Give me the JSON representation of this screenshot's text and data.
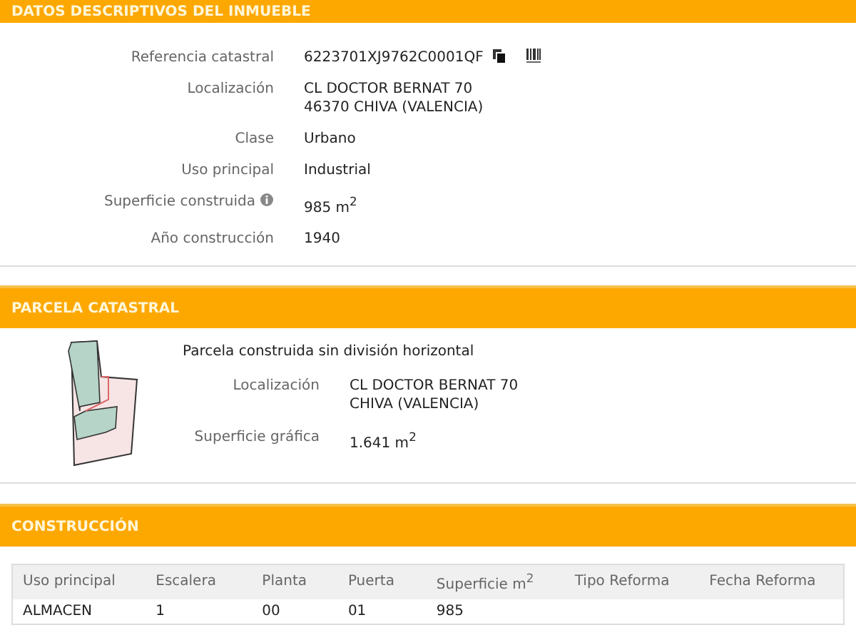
{
  "inmueble": {
    "title": "DATOS DESCRIPTIVOS DEL INMUEBLE",
    "fields": [
      {
        "kind": "ref",
        "label": "Referencia catastral",
        "value": [
          "6223701XJ9762C0001QF"
        ]
      },
      {
        "kind": "plain",
        "label": "Localización",
        "value": [
          "CL DOCTOR BERNAT 70",
          "46370 CHIVA (VALENCIA)"
        ]
      },
      {
        "kind": "plain",
        "label": "Clase",
        "value": [
          "Urbano"
        ]
      },
      {
        "kind": "plain",
        "label": "Uso principal",
        "value": [
          "Industrial"
        ]
      },
      {
        "kind": "info",
        "label": "Superficie construida",
        "value": [
          "985 m$^{2}$"
        ]
      },
      {
        "kind": "plain",
        "label": "Año construcción",
        "value": [
          "1940"
        ]
      }
    ]
  },
  "parcela": {
    "title": "PARCELA CATASTRAL",
    "description": "Parcela construida sin división horizontal",
    "fields": [
      {
        "label": "Localización",
        "value": [
          "CL DOCTOR BERNAT 70",
          "CHIVA (VALENCIA)"
        ]
      },
      {
        "label": "Superficie gráfica",
        "value": [
          "1.641 m$^{2}$"
        ]
      }
    ]
  },
  "construccion": {
    "title": "CONSTRUCCIÓN",
    "table": {
      "columns": [
        "Uso principal",
        "Escalera",
        "Planta",
        "Puerta",
        "Superficie m$^{2}$",
        "Tipo Reforma",
        "Fecha Reforma"
      ],
      "rows": [
        [
          "ALMACEN",
          "1",
          "00",
          "01",
          "985",
          "",
          ""
        ]
      ]
    }
  }
}
